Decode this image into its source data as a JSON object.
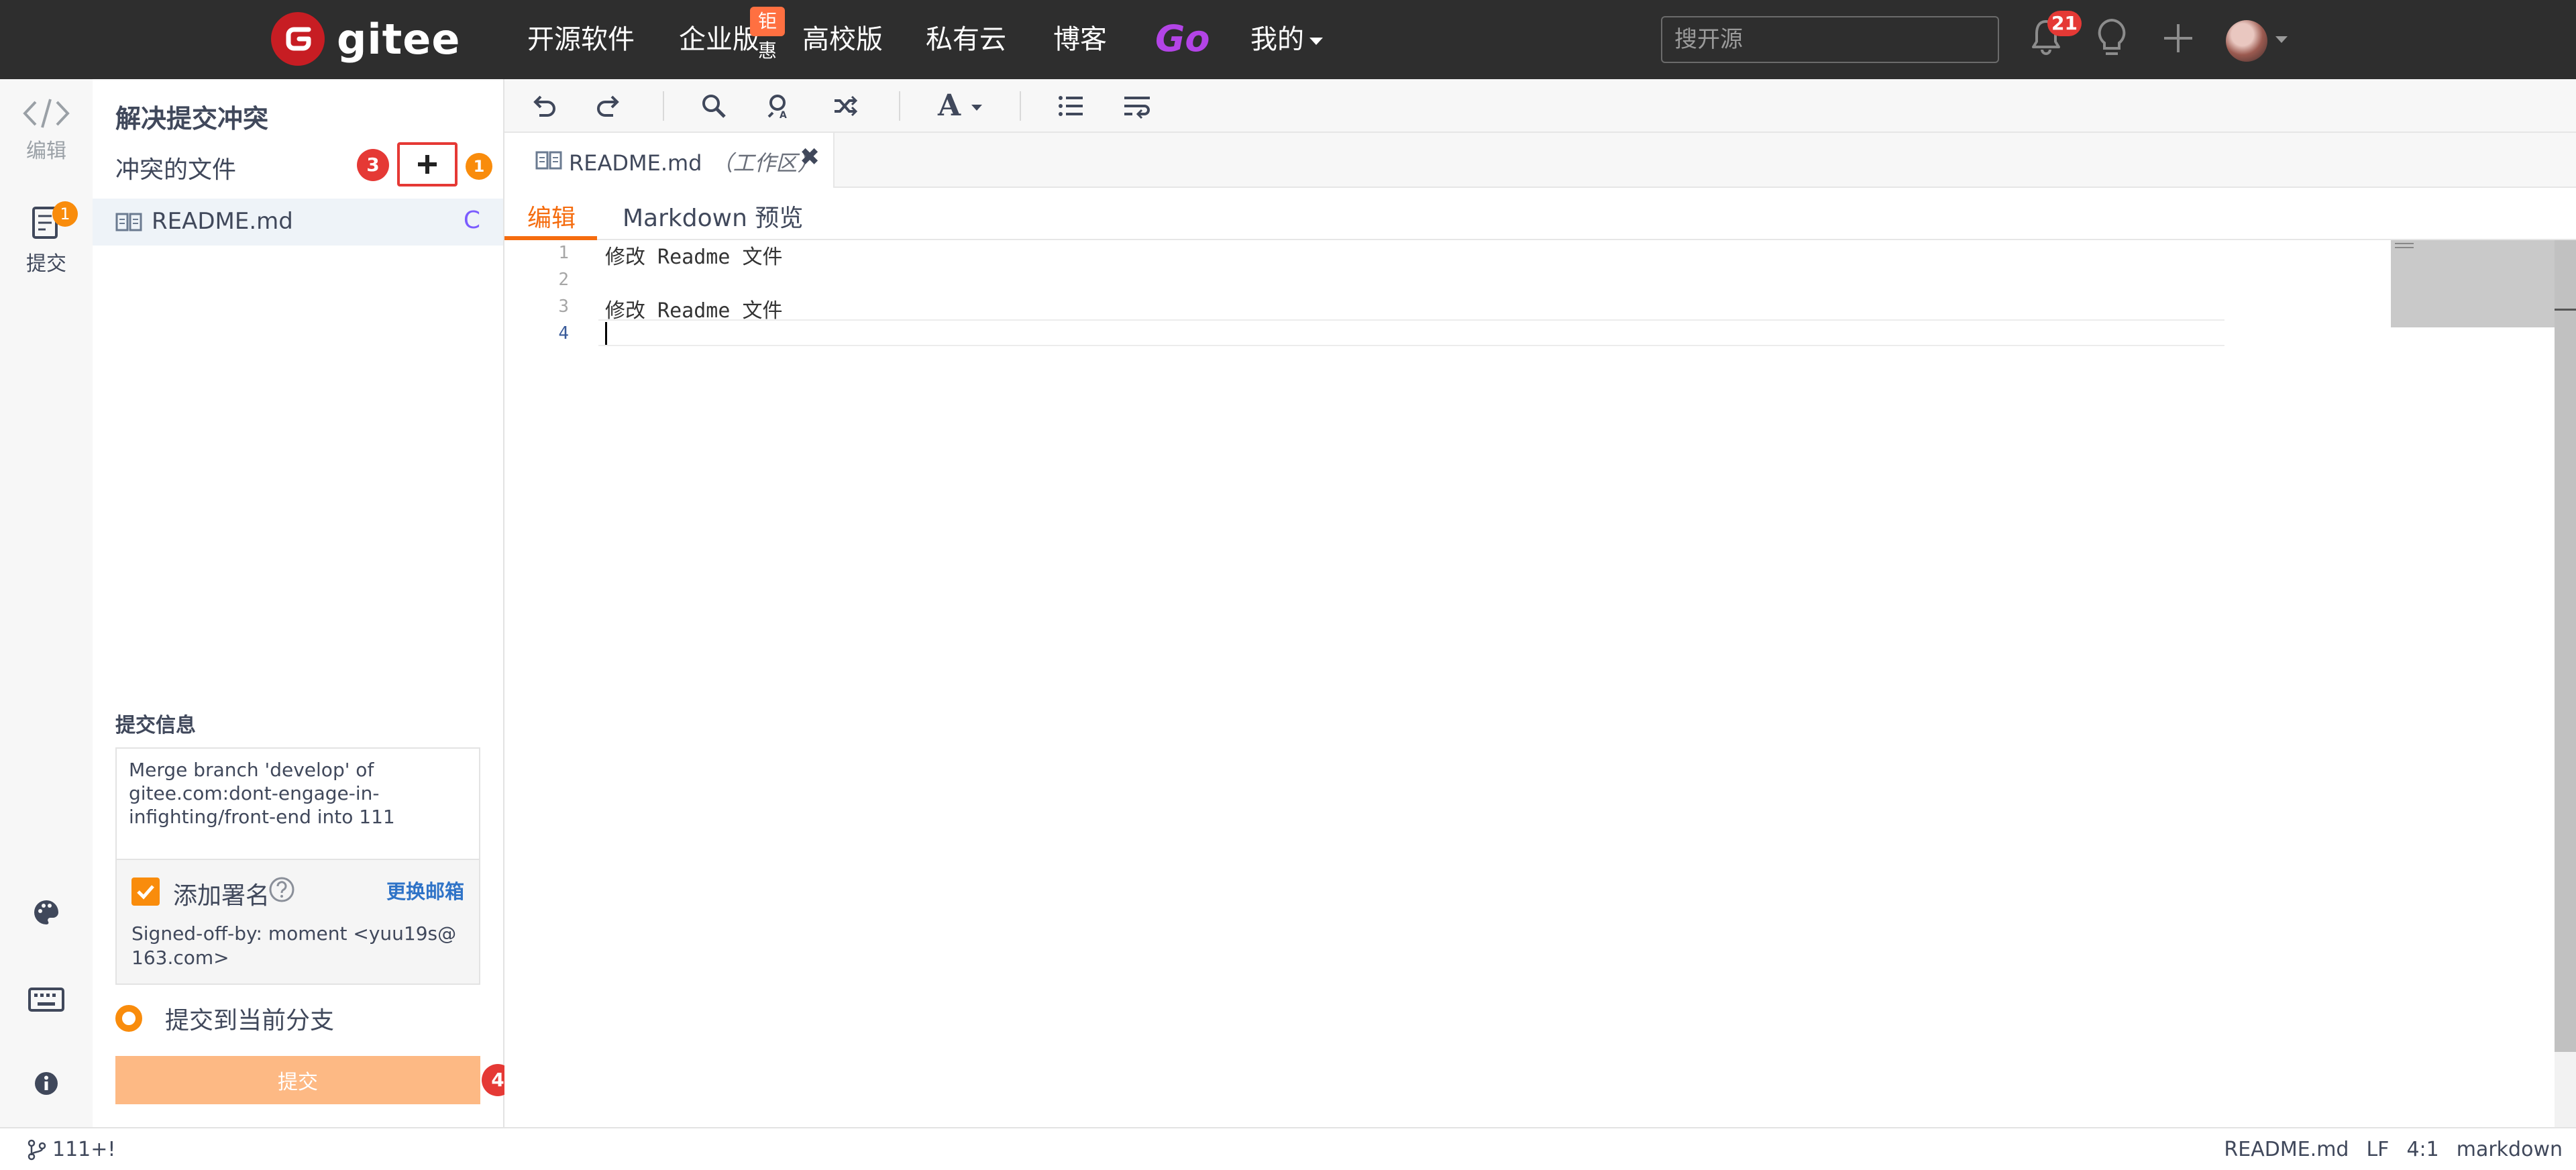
{
  "nav": {
    "brand": "gitee",
    "items": [
      "开源软件",
      "企业版",
      "高校版",
      "私有云",
      "博客"
    ],
    "enterprise_badge": "钜惠",
    "go_label": "Go",
    "mine_label": "我的",
    "search_placeholder": "搜开源",
    "notification_count": "21"
  },
  "activity": {
    "edit_label": "编辑",
    "commit_label": "提交",
    "commit_badge": "1"
  },
  "sidebar": {
    "title": "解决提交冲突",
    "conflict_files_label": "冲突的文件",
    "marker_add": "3",
    "marker_count": "1",
    "files": [
      {
        "name": "README.md",
        "status": "C"
      }
    ],
    "commit_info_label": "提交信息",
    "commit_message": "Merge branch 'develop' of gitee.com:dont-engage-in-infighting/front-end into 111",
    "add_signoff_label": "添加署名",
    "change_email_label": "更换邮箱",
    "signoff_text": "Signed-off-by: moment <yuu19s@163.com>",
    "commit_target_label": "提交到当前分支",
    "submit_label": "提交",
    "marker_submit": "4"
  },
  "editor": {
    "tab_name": "README.md",
    "tab_hint": "（工作区）",
    "mode_tabs": [
      "编辑",
      "Markdown 预览"
    ],
    "lines": [
      {
        "number": "1",
        "text": "修改 Readme 文件"
      },
      {
        "number": "2",
        "text": ""
      },
      {
        "number": "3",
        "text": "修改 Readme 文件"
      },
      {
        "number": "4",
        "text": ""
      }
    ]
  },
  "status": {
    "branch": "111+!",
    "file": "README.md",
    "eol": "LF",
    "position": "4:1",
    "language": "markdown"
  },
  "colors": {
    "accent": "#f98c0c",
    "brand_red": "#c71d23",
    "go_purple": "#b344e6",
    "marker_red": "#e53935",
    "submit_disabled": "#fdb984"
  }
}
